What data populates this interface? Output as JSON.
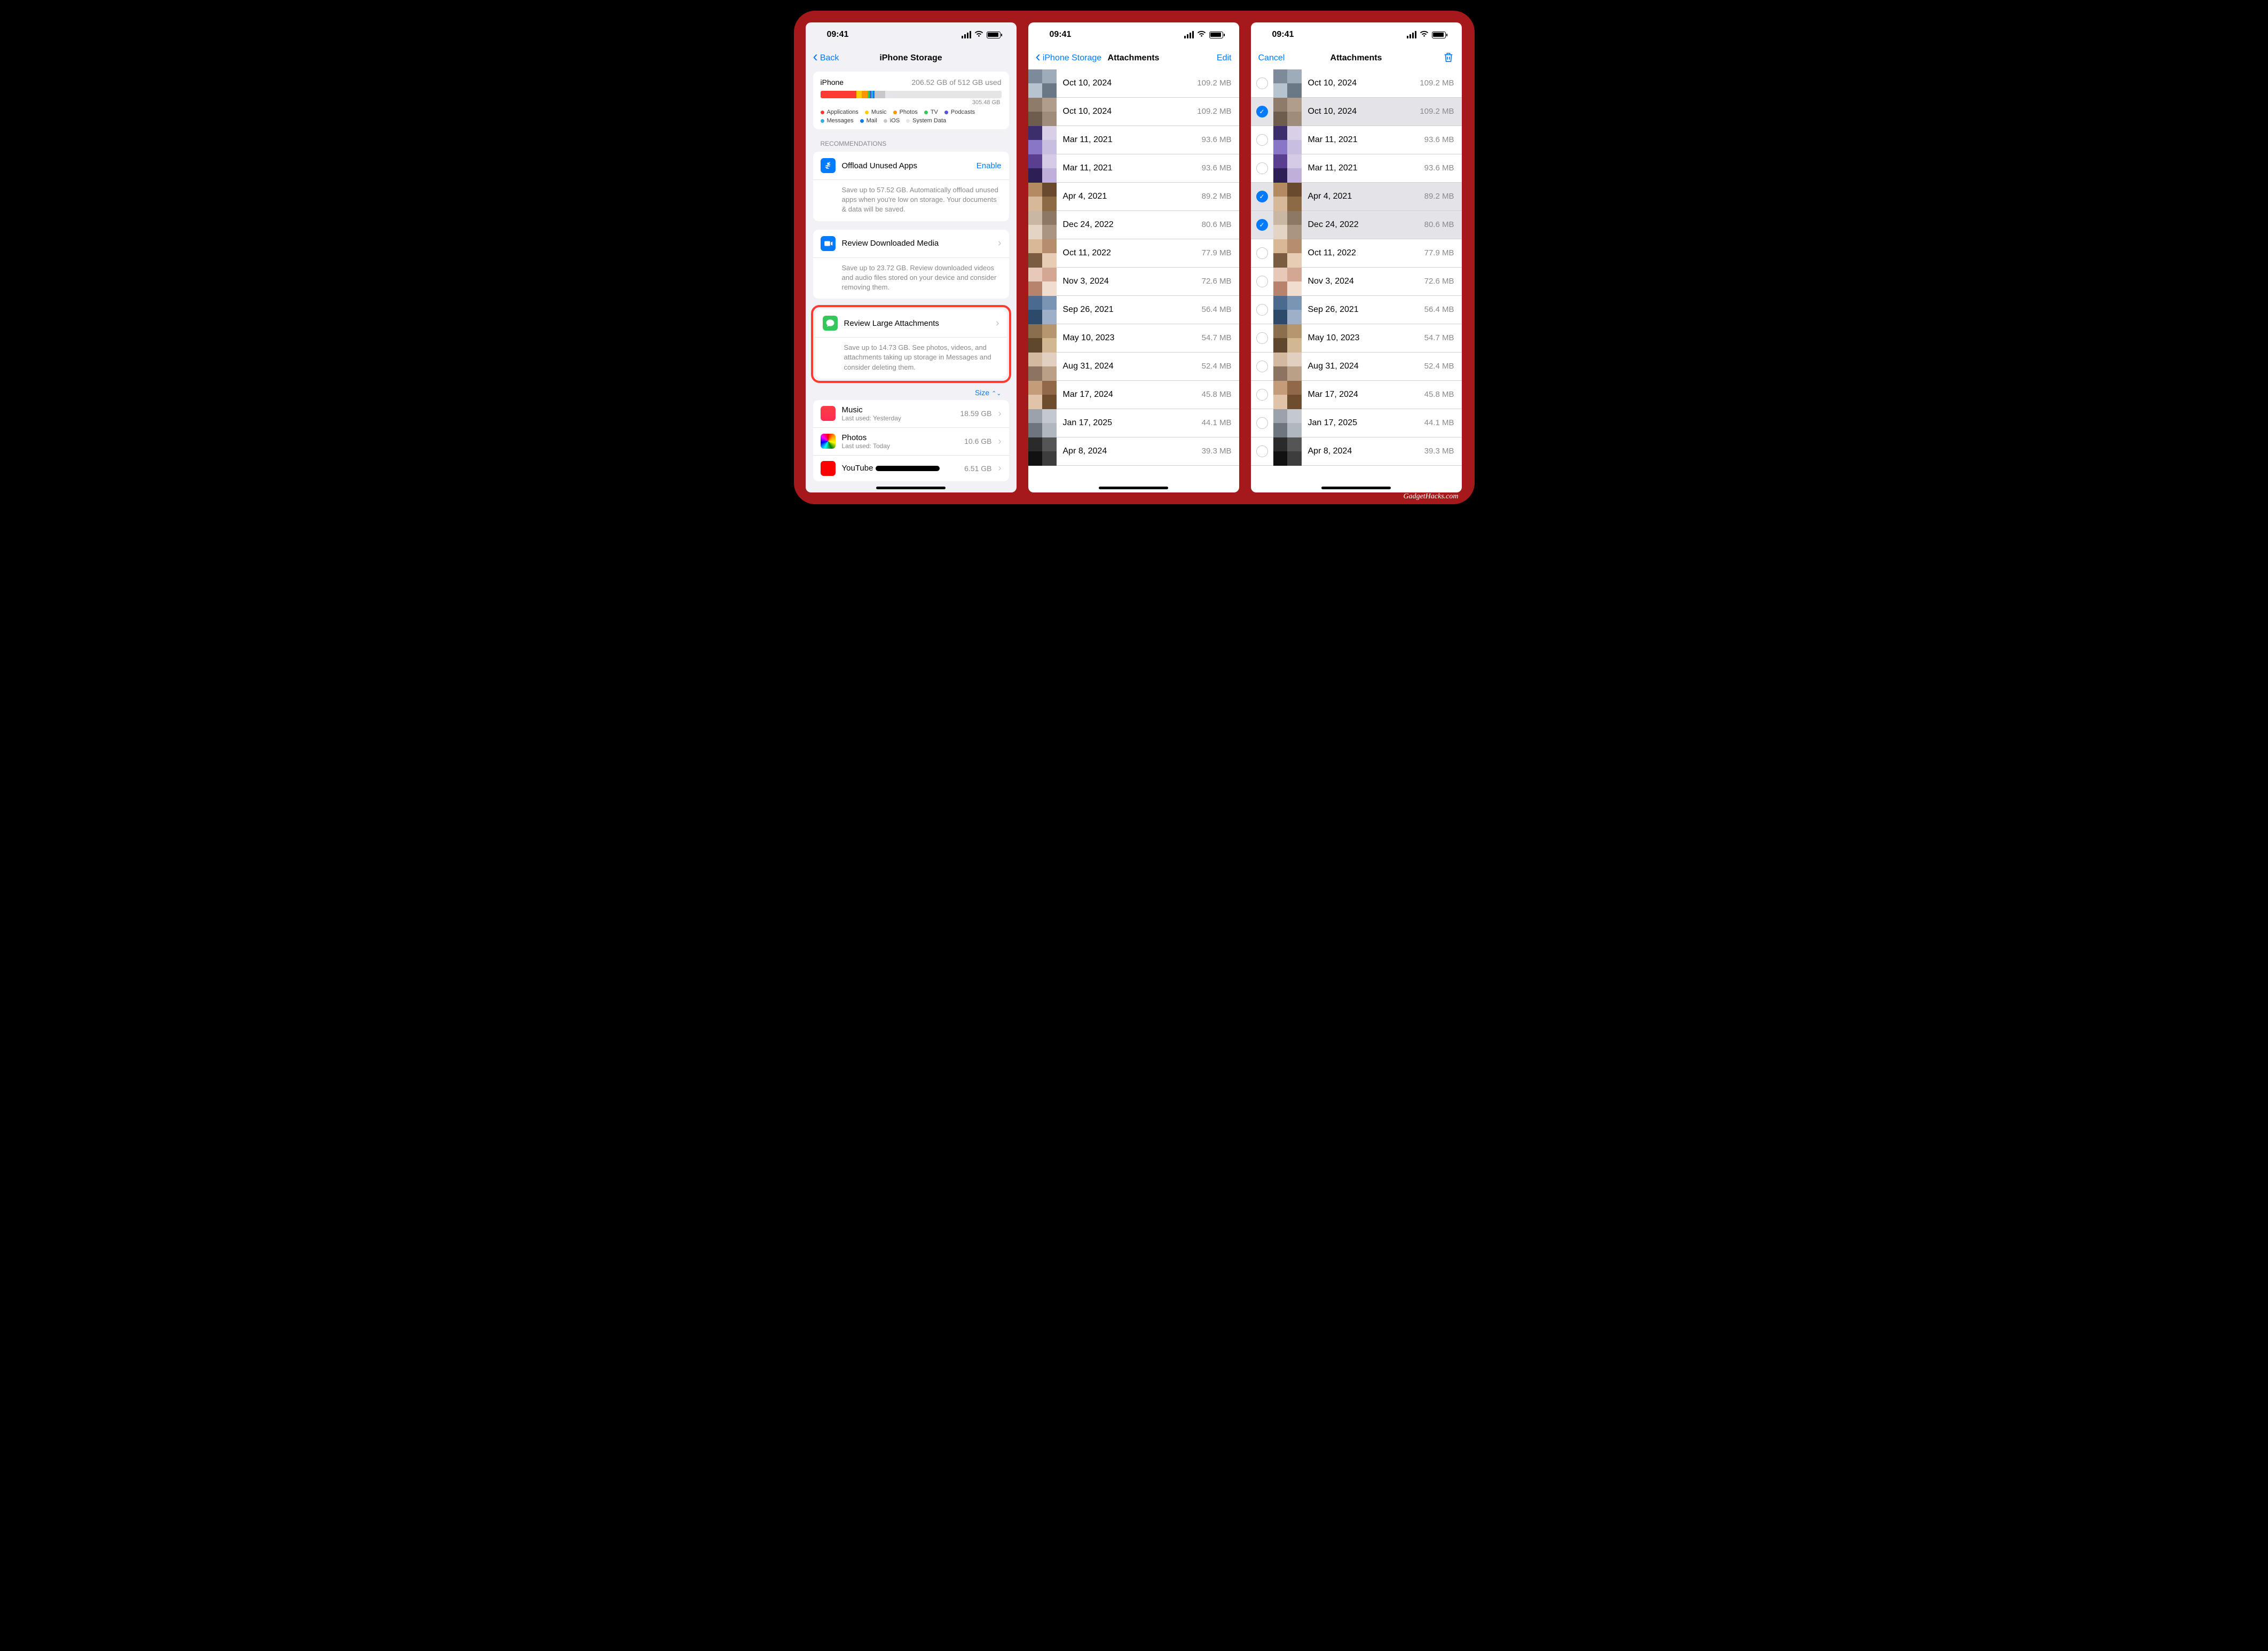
{
  "watermark": "GadgetHacks.com",
  "status_time": "09:41",
  "screen1": {
    "back": "Back",
    "title": "iPhone Storage",
    "device": "iPhone",
    "used_text": "206.52 GB of 512 GB used",
    "free_label": "305.48 GB",
    "legend": [
      {
        "label": "Applications",
        "color": "#ff3b30"
      },
      {
        "label": "Music",
        "color": "#ffcc00"
      },
      {
        "label": "Photos",
        "color": "#ff9500"
      },
      {
        "label": "TV",
        "color": "#34c759"
      },
      {
        "label": "Podcasts",
        "color": "#5856d6"
      },
      {
        "label": "Messages",
        "color": "#32ade6"
      },
      {
        "label": "Mail",
        "color": "#007aff"
      },
      {
        "label": "iOS",
        "color": "#c7c7cc"
      },
      {
        "label": "System Data",
        "color": "#e5e5ea"
      }
    ],
    "segments": [
      {
        "color": "#ff3b30",
        "pct": 20
      },
      {
        "color": "#ffcc00",
        "pct": 3
      },
      {
        "color": "#ff9500",
        "pct": 3
      },
      {
        "color": "#34c759",
        "pct": 1.2
      },
      {
        "color": "#5856d6",
        "pct": 1
      },
      {
        "color": "#32ade6",
        "pct": 1
      },
      {
        "color": "#007aff",
        "pct": 0.8
      },
      {
        "color": "#c7c7cc",
        "pct": 6
      },
      {
        "color": "#e5e5ea",
        "pct": 4
      }
    ],
    "recommendations_header": "Recommendations",
    "rec_offload": {
      "title": "Offload Unused Apps",
      "action": "Enable",
      "desc": "Save up to 57.52 GB. Automatically offload unused apps when you're low on storage. Your documents & data will be saved."
    },
    "rec_media": {
      "title": "Review Downloaded Media",
      "desc": "Save up to 23.72 GB. Review downloaded videos and audio files stored on your device and consider removing them."
    },
    "rec_attachments": {
      "title": "Review Large Attachments",
      "desc": "Save up to 14.73 GB. See photos, videos, and attachments taking up storage in Messages and consider deleting them."
    },
    "sort_label": "Size",
    "apps": [
      {
        "name": "Music",
        "sub": "Last used: Yesterday",
        "size": "18.59 GB",
        "icon": "linear-gradient(180deg,#fc3c44,#ff2d55)"
      },
      {
        "name": "Photos",
        "sub": "Last used: Today",
        "size": "10.6 GB",
        "icon": "conic-gradient(red,orange,yellow,green,cyan,blue,magenta,red)"
      },
      {
        "name": "YouTube",
        "sub": "",
        "size": "6.51 GB",
        "icon": "linear-gradient(#ff0000,#ff0000)"
      }
    ]
  },
  "screen2": {
    "back": "iPhone Storage",
    "title": "Attachments",
    "edit": "Edit"
  },
  "screen3": {
    "cancel": "Cancel",
    "title": "Attachments"
  },
  "attachments": [
    {
      "date": "Oct 10, 2024",
      "size": "109.2 MB",
      "sel": false,
      "c": [
        "#7d8a99",
        "#9eacba",
        "#b7c3cf",
        "#6a7785"
      ]
    },
    {
      "date": "Oct 10, 2024",
      "size": "109.2 MB",
      "sel": true,
      "c": [
        "#8f7b6a",
        "#b19d8b",
        "#6e5c4d",
        "#a08c7a"
      ]
    },
    {
      "date": "Mar 11, 2021",
      "size": "93.6 MB",
      "sel": false,
      "c": [
        "#3b2e6a",
        "#d9d0e8",
        "#8a76c7",
        "#c8bedf"
      ]
    },
    {
      "date": "Mar 11, 2021",
      "size": "93.6 MB",
      "sel": false,
      "c": [
        "#5a3e8f",
        "#d6cbe6",
        "#2d1f55",
        "#bfb0da"
      ]
    },
    {
      "date": "Apr 4, 2021",
      "size": "89.2 MB",
      "sel": true,
      "c": [
        "#b48a63",
        "#6a4a2e",
        "#d7b999",
        "#8c6a46"
      ]
    },
    {
      "date": "Dec 24, 2022",
      "size": "80.6 MB",
      "sel": true,
      "c": [
        "#c9b6a3",
        "#8d7864",
        "#e3d4c3",
        "#a99581"
      ]
    },
    {
      "date": "Oct 11, 2022",
      "size": "77.9 MB",
      "sel": false,
      "c": [
        "#d9b896",
        "#b58f6d",
        "#7a5c41",
        "#e6cdb4"
      ]
    },
    {
      "date": "Nov 3, 2024",
      "size": "72.6 MB",
      "sel": false,
      "c": [
        "#e8c9b9",
        "#d4a794",
        "#b8836d",
        "#f1dcd0"
      ]
    },
    {
      "date": "Sep 26, 2021",
      "size": "56.4 MB",
      "sel": false,
      "c": [
        "#4a6a8f",
        "#7a94b3",
        "#2e4a6a",
        "#9db0c7"
      ]
    },
    {
      "date": "May 10, 2023",
      "size": "54.7 MB",
      "sel": false,
      "c": [
        "#8a6e4e",
        "#b5966f",
        "#5e472d",
        "#d1b892"
      ]
    },
    {
      "date": "Aug 31, 2024",
      "size": "52.4 MB",
      "sel": false,
      "c": [
        "#d3b9a0",
        "#e1d0bf",
        "#8c7560",
        "#bba088"
      ]
    },
    {
      "date": "Mar 17, 2024",
      "size": "45.8 MB",
      "sel": false,
      "c": [
        "#c49c7a",
        "#8f6948",
        "#e0c3a8",
        "#6e4c2e"
      ]
    },
    {
      "date": "Jan 17, 2025",
      "size": "44.1 MB",
      "sel": false,
      "c": [
        "#9aa3ac",
        "#c3c9cf",
        "#6d767f",
        "#b0b7be"
      ]
    },
    {
      "date": "Apr 8, 2024",
      "size": "39.3 MB",
      "sel": false,
      "c": [
        "#2a2a2a",
        "#555",
        "#111",
        "#3d3d3d"
      ]
    }
  ]
}
